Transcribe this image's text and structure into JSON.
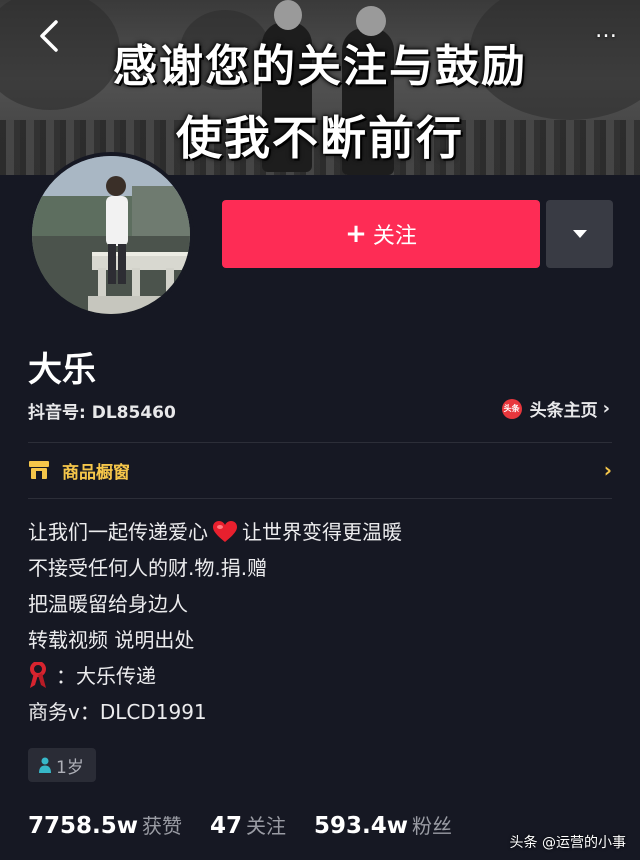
{
  "header": {
    "banner_line1": "感谢您的关注与鼓励",
    "banner_line2": "使我不断前行",
    "more": "…"
  },
  "actions": {
    "follow_label": "关注",
    "follow_color": "#fe2c55"
  },
  "profile": {
    "name": "大乐",
    "douyin_id": "抖音号: DL85460",
    "toutiao_badge": "头条",
    "toutiao_link": "头条主页"
  },
  "shop": {
    "label": "商品橱窗",
    "accent": "#f5c64a"
  },
  "bio": {
    "line1_a": "让我们一起传递爱心",
    "line1_b": "让世界变得更温暖",
    "line2": "不接受任何人的财.物.捐.赠",
    "line3": "把温暖留给身边人",
    "line4": "转载视频 说明出处",
    "line5": "：大乐传递",
    "line6": "商务v：DLCD1991"
  },
  "age_tag": "1岁",
  "stats": {
    "likes_value": "7758.5w",
    "likes_label": "获赞",
    "following_value": "47",
    "following_label": "关注",
    "fans_value": "593.4w",
    "fans_label": "粉丝"
  },
  "watermark": "头条 @运营的小事",
  "icons": [
    "back-icon",
    "more-icon",
    "plus-icon",
    "dropdown-icon",
    "toutiao-icon",
    "chevron-right-icon",
    "shop-icon",
    "heart-icon",
    "ribbon-icon",
    "person-icon"
  ]
}
